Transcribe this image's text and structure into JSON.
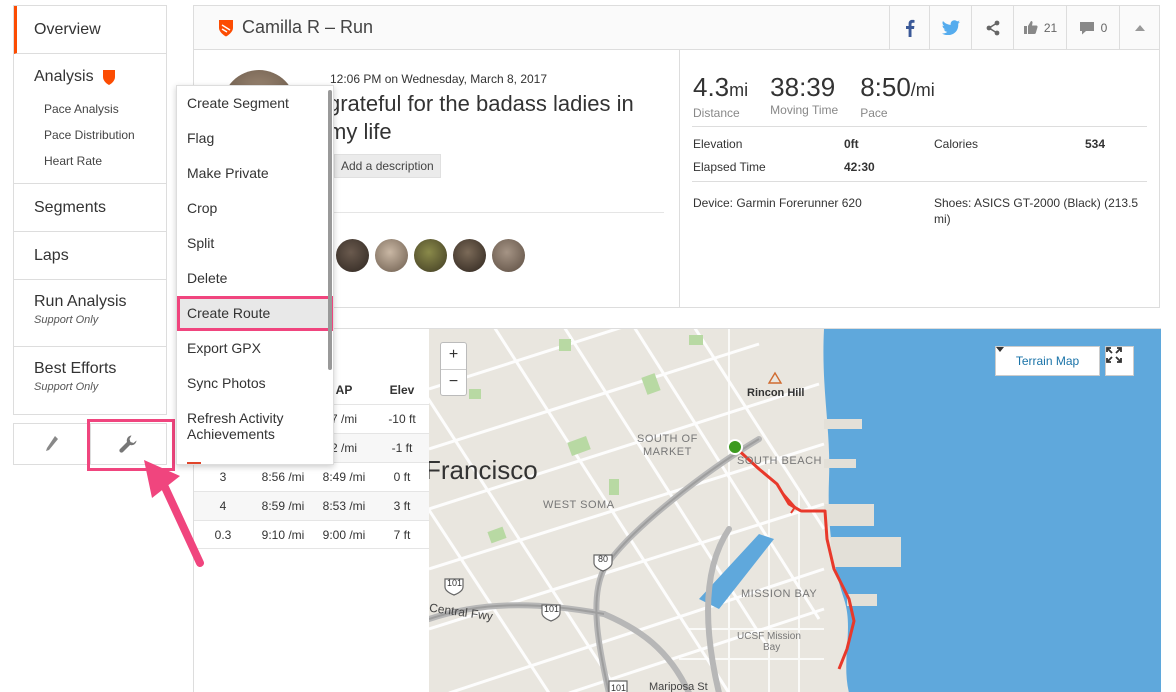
{
  "sidebar": {
    "overview": "Overview",
    "analysis": "Analysis",
    "analysis_sub": [
      "Pace Analysis",
      "Pace Distribution",
      "Heart Rate"
    ],
    "segments": "Segments",
    "laps": "Laps",
    "run_analysis": "Run Analysis",
    "run_analysis_note": "Support Only",
    "best_efforts": "Best Efforts",
    "best_efforts_note": "Support Only"
  },
  "header": {
    "title": "Camilla R – Run",
    "kudos_count": "21",
    "comment_count": "0"
  },
  "activity": {
    "date": "12:06 PM on Wednesday, March 8, 2017",
    "title": "grateful for the badass ladies in my life",
    "description_button": "Add a description"
  },
  "stats": {
    "distance_value": "4.3",
    "distance_unit": "mi",
    "distance_label": "Distance",
    "moving_time_value": "38:39",
    "moving_time_label": "Moving Time",
    "pace_value": "8:50",
    "pace_unit": "/mi",
    "pace_label": "Pace",
    "elevation_label": "Elevation",
    "elevation_value": "0ft",
    "elapsed_label": "Elapsed Time",
    "elapsed_value": "42:30",
    "calories_label": "Calories",
    "calories_value": "534",
    "device": "Device: Garmin Forerunner 620",
    "shoes": "Shoes: ASICS GT-2000 (Black) (213.5 mi)"
  },
  "menu": {
    "items": [
      "Create Segment",
      "Flag",
      "Make Private",
      "Crop",
      "Split",
      "Delete",
      "Create Route",
      "Export GPX",
      "Sync Photos",
      "Refresh Activity Achievements"
    ]
  },
  "splits": {
    "headers": [
      "",
      "",
      "AP",
      "Elev"
    ],
    "rows": [
      [
        "",
        "",
        "7 /mi",
        "-10 ft"
      ],
      [
        "",
        "",
        "2 /mi",
        "-1 ft"
      ],
      [
        "3",
        "8:56 /mi",
        "8:49 /mi",
        "0 ft"
      ],
      [
        "4",
        "8:59 /mi",
        "8:53 /mi",
        "3 ft"
      ],
      [
        "0.3",
        "9:10 /mi",
        "9:00 /mi",
        "7 ft"
      ]
    ]
  },
  "map": {
    "zoom_in": "+",
    "zoom_out": "−",
    "terrain_button": "Terrain Map",
    "labels": {
      "francisco": "Francisco",
      "rincon": "Rincon Hill",
      "south_of_market_1": "SOUTH OF",
      "south_of_market_2": "MARKET",
      "south_beach": "SOUTH BEACH",
      "west_soma": "WEST SOMA",
      "mission_bay": "MISSION BAY",
      "ucsf_1": "UCSF Mission",
      "ucsf_2": "Bay",
      "central_fwy": "Central Fwy",
      "hwy_101a": "101",
      "hwy_101b": "101",
      "hwy_101c": "101",
      "hwy_80": "80",
      "mariposa": "Mariposa St"
    }
  },
  "colors": {
    "strava_orange": "#fc4c02",
    "highlight_pink": "#f0457e",
    "route_red": "#e8392b",
    "water_blue": "#5fa8dc"
  }
}
